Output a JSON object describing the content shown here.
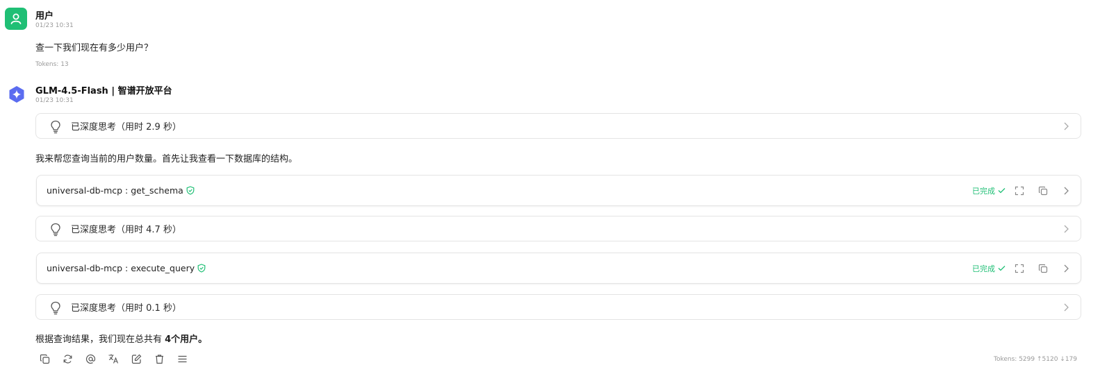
{
  "user_message": {
    "name": "用户",
    "time": "01/23 10:31",
    "text": "查一下我们现在有多少用户？",
    "tokens": "Tokens: 13",
    "avatar_color": "#1fbf75"
  },
  "ai_message": {
    "name": "GLM-4.5-Flash | 智谱开放平台",
    "time": "01/23 10:31",
    "think_1": "已深度思考（用时 2.9 秒）",
    "intro_text": "我来帮您查询当前的用户数量。首先让我查看一下数据库的结构。",
    "tool_1": {
      "label": "universal-db-mcp : get_schema",
      "status": "已完成"
    },
    "think_2": "已深度思考（用时 4.7 秒）",
    "tool_2": {
      "label": "universal-db-mcp : execute_query",
      "status": "已完成"
    },
    "think_3": "已深度思考（用时 0.1 秒）",
    "result_prefix": "根据查询结果，我们现在总共有 ",
    "result_bold": "4个用户。",
    "tokens": "Tokens: 5299 ↑5120 ↓179",
    "status_color": "#1fbf75",
    "ai_icon_color": "#5b6cf0"
  },
  "toolbar_icons": [
    "copy-icon",
    "regenerate-icon",
    "mention-icon",
    "translate-icon",
    "edit-icon",
    "delete-icon",
    "menu-icon"
  ]
}
